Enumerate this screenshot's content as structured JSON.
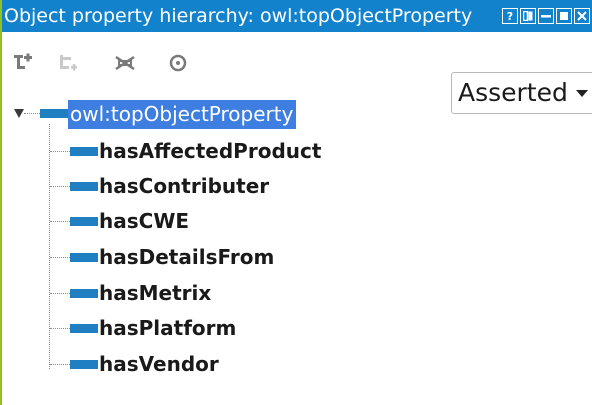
{
  "window": {
    "title": "Object property hierarchy: owl:topObjectProperty",
    "buttons": [
      "help",
      "restore",
      "minimize",
      "maximize",
      "close"
    ]
  },
  "toolbar": {
    "icons": [
      "add-sub-property-icon",
      "add-sibling-property-icon",
      "delete-property-icon",
      "search-icon"
    ],
    "view_mode": "Asserted"
  },
  "tree": {
    "root": "owl:topObjectProperty",
    "children": [
      "hasAffectedProduct",
      "hasContributer",
      "hasCWE",
      "hasDetailsFrom",
      "hasMetrix",
      "hasPlatform",
      "hasVendor"
    ]
  },
  "colors": {
    "title_bar": "#1382cc",
    "selection": "#3d7ee0",
    "property_icon": "#1f7fc1",
    "left_border": "#8fc21c"
  }
}
